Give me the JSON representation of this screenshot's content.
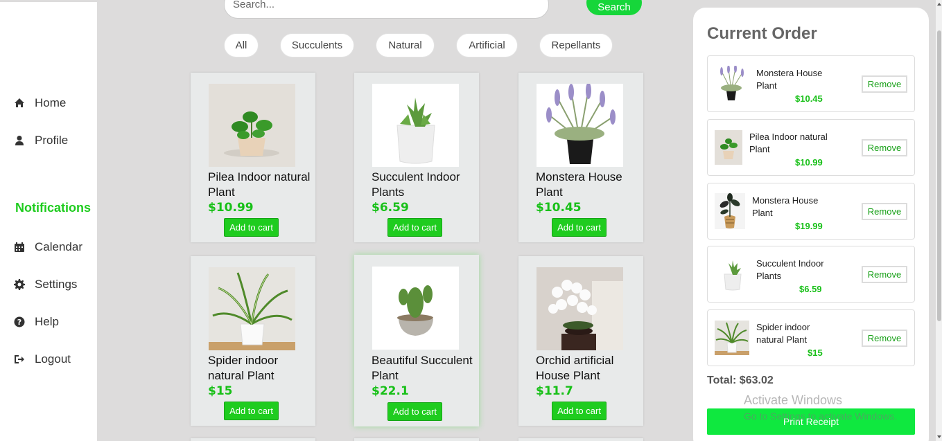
{
  "sidebar": {
    "items": [
      {
        "label": "Home",
        "icon": "home-icon"
      },
      {
        "label": "Profile",
        "icon": "user-icon"
      },
      {
        "label": "Calendar",
        "icon": "calendar-icon"
      },
      {
        "label": "Settings",
        "icon": "gear-icon"
      },
      {
        "label": "Help",
        "icon": "help-icon"
      },
      {
        "label": "Logout",
        "icon": "logout-icon"
      }
    ],
    "notifications_label": "Notifications"
  },
  "search": {
    "placeholder": "Search...",
    "button_label": "Search"
  },
  "filters": [
    "All",
    "Succulents",
    "Natural",
    "Artificial",
    "Repellants"
  ],
  "products": [
    {
      "name": "Pilea Indoor natural Plant",
      "price": "$10.99",
      "button": "Add to cart",
      "image": "pilea-plant-image"
    },
    {
      "name": "Succulent Indoor Plants",
      "price": "$6.59",
      "button": "Add to cart",
      "image": "succulent-plant-image"
    },
    {
      "name": "Monstera House Plant",
      "price": "$10.45",
      "button": "Add to cart",
      "image": "lavender-plant-image"
    },
    {
      "name": "Spider indoor natural Plant",
      "price": "$15",
      "button": "Add to cart",
      "image": "spider-plant-image"
    },
    {
      "name": "Beautiful Succulent Plant",
      "price": "$22.1",
      "button": "Add to cart",
      "image": "cactus-plant-image"
    },
    {
      "name": "Orchid artificial House Plant",
      "price": "$11.7",
      "button": "Add to cart",
      "image": "orchid-plant-image"
    }
  ],
  "order": {
    "title": "Current Order",
    "items": [
      {
        "name": "Monstera House Plant",
        "price": "$10.45",
        "remove": "Remove"
      },
      {
        "name": "Pilea Indoor natural Plant",
        "price": "$10.99",
        "remove": "Remove"
      },
      {
        "name": "Monstera House Plant",
        "price": "$19.99",
        "remove": "Remove"
      },
      {
        "name": "Succulent Indoor Plants",
        "price": "$6.59",
        "remove": "Remove"
      },
      {
        "name": "Spider indoor natural Plant",
        "price": "$15",
        "remove": "Remove"
      }
    ],
    "total": "Total: $63.02",
    "print_label": "Print Receipt"
  },
  "watermark": {
    "line1": "Activate Windows",
    "line2": "Go to Settings to activate Windows."
  },
  "colors": {
    "accent": "#1fcc1f",
    "price": "#18c018",
    "background": "#dddcdc"
  }
}
